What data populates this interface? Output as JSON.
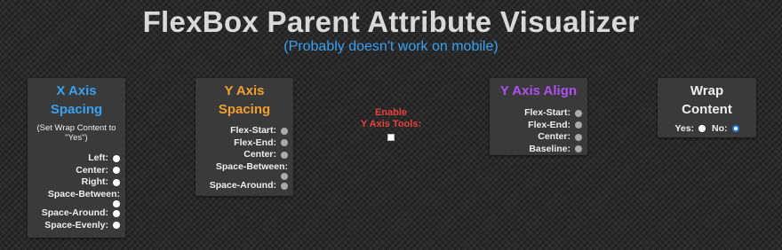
{
  "header": {
    "title": "FlexBox Parent Attribute Visualizer",
    "subtitle": "(Probably doesn't work on mobile)"
  },
  "colors": {
    "x_axis": "#3aa0f0",
    "y_axis": "#f0a030",
    "y_align": "#b050f0",
    "enable": "#e8403a"
  },
  "x_spacing": {
    "title_line1": "X Axis",
    "title_line2": "Spacing",
    "note_line1": "(Set Wrap Content to",
    "note_line2": "\"Yes\")",
    "options": [
      "Left:",
      "Center:",
      "Right:",
      "Space-Between:",
      "Space-Around:",
      "Space-Evenly:"
    ]
  },
  "y_spacing": {
    "title_line1": "Y Axis",
    "title_line2": "Spacing",
    "options": [
      "Flex-Start:",
      "Flex-End:",
      "Center:",
      "Space-Between:",
      "Space-Around:"
    ]
  },
  "enable_y": {
    "line1": "Enable",
    "line2": "Y Axis Tools:",
    "checked": false
  },
  "y_align": {
    "title": "Y Axis Align",
    "options": [
      "Flex-Start:",
      "Flex-End:",
      "Center:",
      "Baseline:"
    ]
  },
  "wrap": {
    "title_line1": "Wrap",
    "title_line2": "Content",
    "yes_label": "Yes:",
    "no_label": "No:",
    "selected": "No"
  }
}
